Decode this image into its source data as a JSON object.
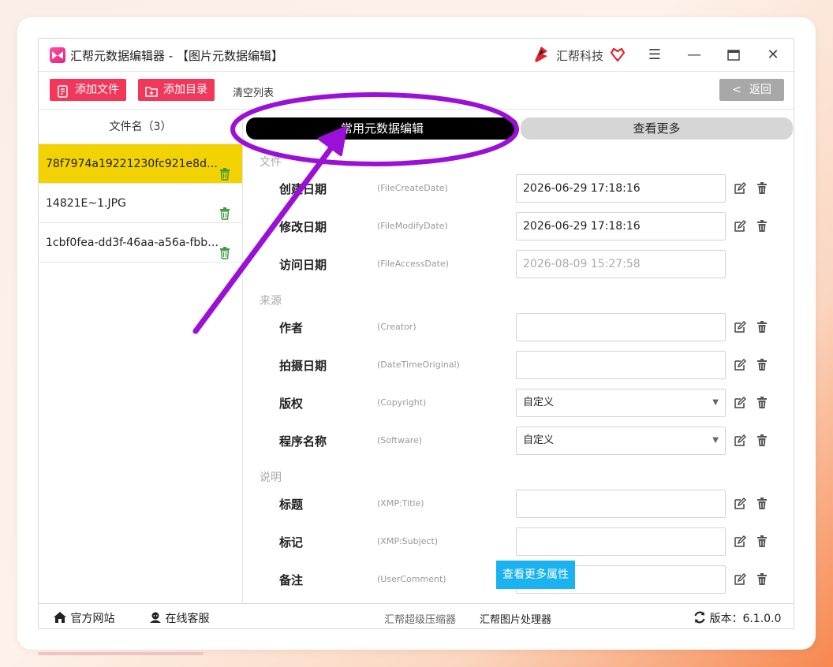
{
  "window": {
    "title": "汇帮元数据编辑器 - 【图片元数据编辑】",
    "brand": "汇帮科技",
    "controls": {
      "menu": "☰",
      "minimize": "—",
      "maximize": "▭",
      "close": "✕"
    }
  },
  "toolbar": {
    "add_file": "添加文件",
    "add_folder": "添加目录",
    "clear_list": "清空列表",
    "back": "返回",
    "back_icon": "<"
  },
  "sidebar": {
    "header": "文件名（3）",
    "files": [
      {
        "name": "78f7974a19221230fc921e8d6e58...",
        "selected": true
      },
      {
        "name": "14821E~1.JPG",
        "selected": false
      },
      {
        "name": "1cbf0fea-dd3f-46aa-a56a-fbb5...",
        "selected": false
      }
    ]
  },
  "tabs": {
    "common": "常用元数据编辑",
    "more": "查看更多"
  },
  "sections": {
    "file": "文件",
    "source": "来源",
    "desc": "说明"
  },
  "fields": {
    "create_date": {
      "label": "创建日期",
      "key": "(FileCreateDate)",
      "value": "2026-06-29 17:18:16"
    },
    "modify_date": {
      "label": "修改日期",
      "key": "(FileModifyDate)",
      "value": "2026-06-29 17:18:16"
    },
    "access_date": {
      "label": "访问日期",
      "key": "(FileAccessDate)",
      "value": "2026-08-09 15:27:58"
    },
    "creator": {
      "label": "作者",
      "key": "(Creator)",
      "value": ""
    },
    "date_original": {
      "label": "拍摄日期",
      "key": "(DateTimeOriginal)",
      "value": ""
    },
    "copyright": {
      "label": "版权",
      "key": "(Copyright)",
      "value": "自定义"
    },
    "software": {
      "label": "程序名称",
      "key": "(Software)",
      "value": "自定义"
    },
    "title": {
      "label": "标题",
      "key": "(XMP:Title)",
      "value": ""
    },
    "subject": {
      "label": "标记",
      "key": "(XMP:Subject)",
      "value": ""
    },
    "comment": {
      "label": "备注",
      "key": "(UserComment)",
      "value": ""
    }
  },
  "more_attributes_button": "查看更多属性",
  "footer": {
    "website": "官方网站",
    "support": "在线客服",
    "compressor": "汇帮超级压缩器",
    "image_processor": "汇帮图片处理器",
    "version_label": "版本：",
    "version": "6.1.0.0"
  },
  "colors": {
    "accent_red": "#f2385a",
    "selected_row": "#f2d200",
    "annotation_purple": "#9b10d6",
    "info_button": "#1ab2f0"
  }
}
